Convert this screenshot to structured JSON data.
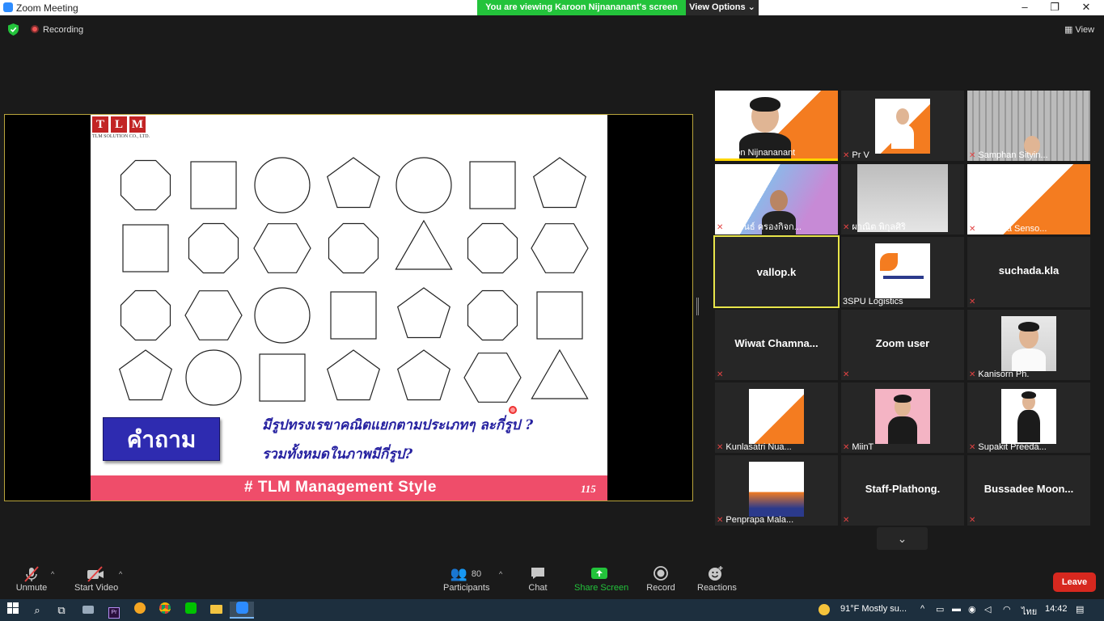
{
  "window": {
    "title": "Zoom Meeting",
    "min": "–",
    "max": "❐",
    "close": "✕"
  },
  "share_banner": {
    "text": "You are viewing Karoon Nijnananant's screen",
    "view_options": "View Options ⌄"
  },
  "meeting": {
    "recording": "Recording",
    "view": "▦ View"
  },
  "slide": {
    "logo_letters": [
      "T",
      "L",
      "M"
    ],
    "logo_sub": "TLM SOLUTION CO., LTD.",
    "question_label": "คำถาม",
    "question_line1": "มีรูปทรงเรขาคณิตแยกตามประเภทๆ ละกี่รูป ?",
    "question_line2": "รวมทั้งหมดในภาพมีกี่รูป?",
    "footer": "# TLM Management Style",
    "page_number": "115",
    "shape_rows": [
      [
        "octagon",
        "square",
        "circle",
        "pentagon",
        "circle",
        "square",
        "pentagon"
      ],
      [
        "square",
        "octagon",
        "hexagon",
        "octagon",
        "triangle",
        "octagon",
        "hexagon"
      ],
      [
        "octagon",
        "hexagon",
        "circle",
        "square",
        "pentagon",
        "octagon",
        "square"
      ],
      [
        "pentagon",
        "circle",
        "square",
        "pentagon",
        "pentagon",
        "hexagon",
        "triangle"
      ]
    ]
  },
  "participants_gallery": [
    {
      "name": "Karoon Nijnananant",
      "muted": false,
      "video": true
    },
    {
      "name": "Pr V",
      "muted": true,
      "video": true
    },
    {
      "name": "Samphan Sityin...",
      "muted": true,
      "video": true
    },
    {
      "name": "สันฟันธ์ ครองกิจก...",
      "muted": true,
      "video": true
    },
    {
      "name": "ผาณิต พิกุลศิริ",
      "muted": true,
      "video": true
    },
    {
      "name": "Supattra Senso...",
      "muted": true,
      "video": true
    },
    {
      "name": "vallop.k",
      "muted": false,
      "video": false
    },
    {
      "name": "3SPU Logistics",
      "muted": false,
      "video": true
    },
    {
      "name": "suchada.kla",
      "muted": true,
      "video": false
    },
    {
      "name": "Wiwat   Chamna...",
      "muted": true,
      "video": false
    },
    {
      "name": "Zoom user",
      "muted": true,
      "video": false
    },
    {
      "name": "Kanisorn Ph.",
      "muted": true,
      "video": true
    },
    {
      "name": "Kunlasatri Nua...",
      "muted": true,
      "video": true
    },
    {
      "name": "MiinT",
      "muted": true,
      "video": true
    },
    {
      "name": "Supakit Preeda...",
      "muted": true,
      "video": true
    },
    {
      "name": "Penprapa Mala...",
      "muted": true,
      "video": true
    },
    {
      "name": "Staff-Plathong.",
      "muted": true,
      "video": false
    },
    {
      "name": "Bussadee  Moon...",
      "muted": true,
      "video": false
    }
  ],
  "toolbar": {
    "unmute": "Unmute",
    "start_video": "Start Video",
    "participants": "Participants",
    "participants_count": "80",
    "chat": "Chat",
    "share_screen": "Share Screen",
    "record": "Record",
    "reactions": "Reactions",
    "leave": "Leave"
  },
  "taskbar": {
    "weather": "91°F  Mostly su...",
    "language": "ไทย",
    "time": "14:42"
  },
  "colors": {
    "share_green": "#23c33b",
    "leave_red": "#d7281f",
    "slide_footer": "#ef4d6a",
    "question_blue": "#2e2bb0"
  }
}
